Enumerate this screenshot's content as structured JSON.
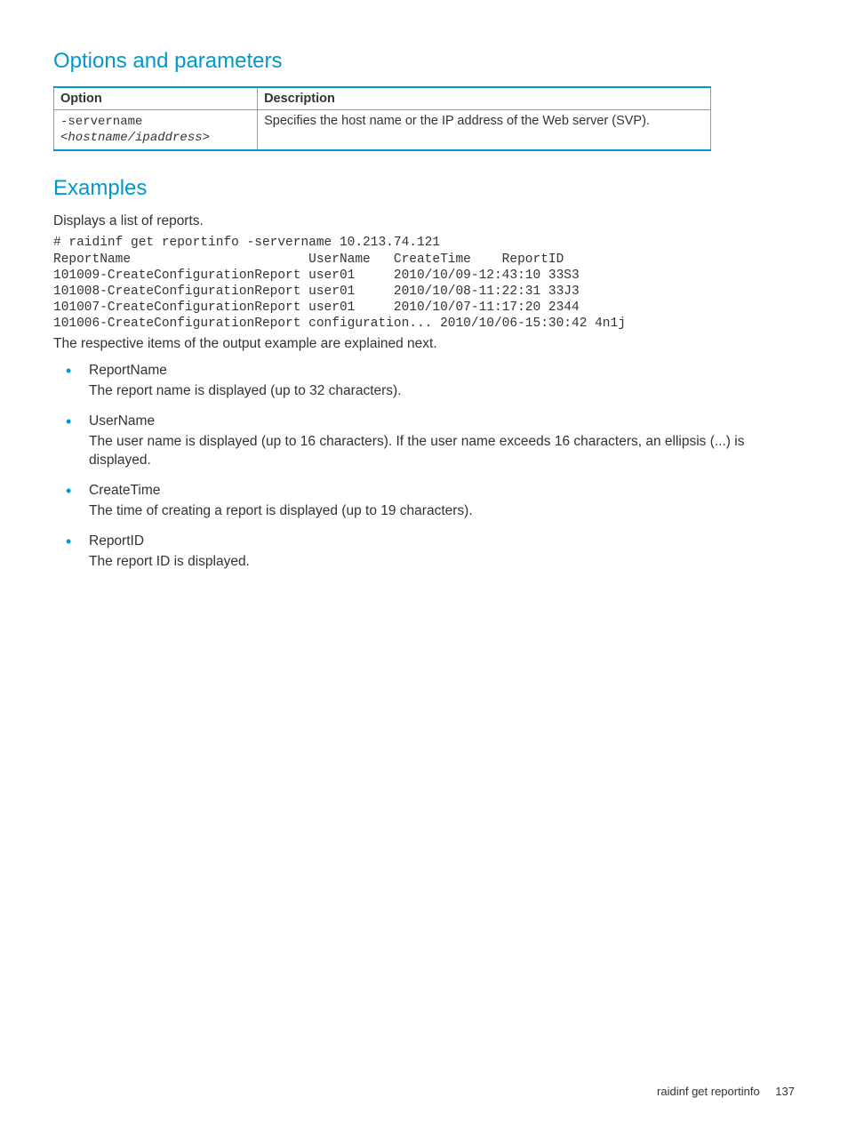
{
  "sections": {
    "options_heading": "Options and parameters",
    "examples_heading": "Examples"
  },
  "table": {
    "headers": {
      "option": "Option",
      "description": "Description"
    },
    "rows": [
      {
        "option_line1": "-servername",
        "option_line2": "<hostname/ipaddress>",
        "description": "Specifies the host name or the IP address of the Web server (SVP)."
      }
    ]
  },
  "examples": {
    "intro": "Displays a list of reports.",
    "code": "# raidinf get reportinfo -servername 10.213.74.121\nReportName                       UserName   CreateTime    ReportID\n101009-CreateConfigurationReport user01     2010/10/09-12:43:10 33S3\n101008-CreateConfigurationReport user01     2010/10/08-11:22:31 33J3\n101007-CreateConfigurationReport user01     2010/10/07-11:17:20 2344\n101006-CreateConfigurationReport configuration... 2010/10/06-15:30:42 4n1j",
    "followup": "The respective items of the output example are explained next.",
    "items": [
      {
        "title": "ReportName",
        "desc": "The report name is displayed (up to 32 characters)."
      },
      {
        "title": "UserName",
        "desc": "The user name is displayed (up to 16 characters). If the user name exceeds 16 characters, an ellipsis (...) is displayed."
      },
      {
        "title": "CreateTime",
        "desc": "The time of creating a report is displayed (up to 19 characters)."
      },
      {
        "title": "ReportID",
        "desc": "The report ID is displayed."
      }
    ]
  },
  "footer": {
    "title": "raidinf get reportinfo",
    "page": "137"
  }
}
